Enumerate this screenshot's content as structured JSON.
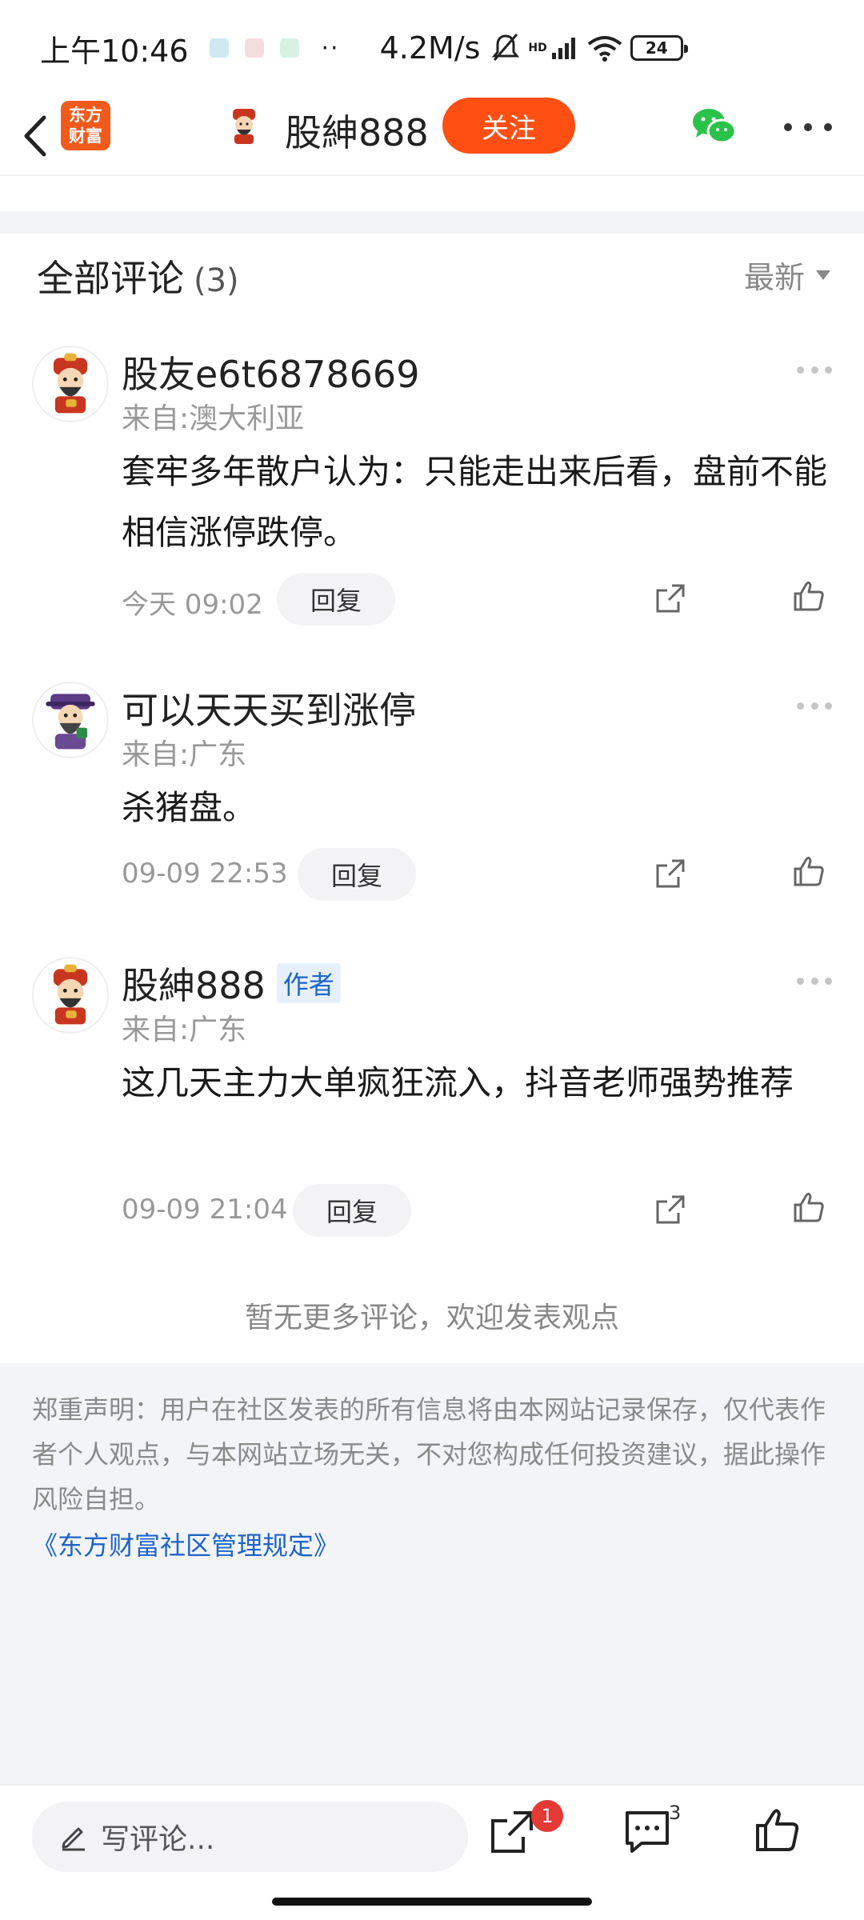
{
  "status_bar": {
    "time": "上午10:46",
    "dots": "··",
    "network_speed": "4.2M/s",
    "network_label": "HD",
    "battery": "24"
  },
  "header": {
    "logo_text": "东方财富",
    "title": "股紳888",
    "follow_label": "关注"
  },
  "comments_section": {
    "title": "全部评论",
    "count": "(3)",
    "sort_label": "最新"
  },
  "comments": [
    {
      "name": "股友e6t6878669",
      "location": "来自:澳大利亚",
      "text": "套牢多年散户认为：只能走出来后看，盘前不能相信涨停跌停。",
      "time": "今天 09:02",
      "reply_label": "回复"
    },
    {
      "name": "可以天天买到涨停",
      "location": "来自:广东",
      "text": "杀猪盘。",
      "time": "09-09 22:53",
      "reply_label": "回复"
    },
    {
      "name": "股紳888",
      "tag": "作者",
      "location": "来自:广东",
      "text": "这几天主力大单疯狂流入，抖音老师强势推荐",
      "time": "09-09 21:04",
      "reply_label": "回复"
    }
  ],
  "no_more_text": "暂无更多评论，欢迎发表观点",
  "disclaimer": {
    "text": "郑重声明：用户在社区发表的所有信息将由本网站记录保存，仅代表作者个人观点，与本网站立场无关，不对您构成任何投资建议，据此操作风险自担。",
    "link": "《东方财富社区管理规定》"
  },
  "bottom_bar": {
    "input_placeholder": "写评论...",
    "share_badge": "1",
    "comment_count": "3"
  },
  "colors": {
    "accent": "#ff4f12",
    "link": "#1e64c8",
    "badge": "#e53935"
  }
}
